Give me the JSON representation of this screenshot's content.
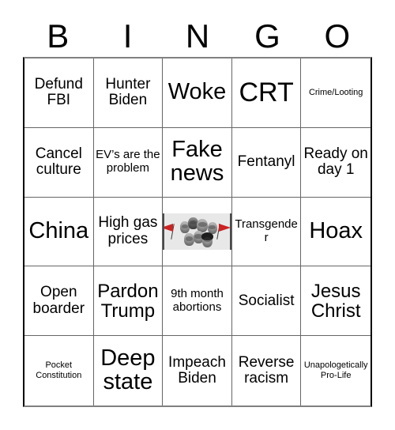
{
  "card": {
    "header_letters": [
      "B",
      "I",
      "N",
      "G",
      "O"
    ],
    "rows": [
      [
        {
          "text": "Defund FBI",
          "size": "m"
        },
        {
          "text": "Hunter Biden",
          "size": "m"
        },
        {
          "text": "Woke",
          "size": "xl"
        },
        {
          "text": "CRT",
          "size": "xxl"
        },
        {
          "text": "Crime/Looting",
          "size": "xs"
        }
      ],
      [
        {
          "text": "Cancel culture",
          "size": "m"
        },
        {
          "text": "EV’s are the problem",
          "size": "s"
        },
        {
          "text": "Fake news",
          "size": "xl"
        },
        {
          "text": "Fentanyl",
          "size": "m"
        },
        {
          "text": "Ready on day 1",
          "size": "m"
        }
      ],
      [
        {
          "text": "China",
          "size": "xl"
        },
        {
          "text": "High gas prices",
          "size": "m"
        },
        {
          "text": "",
          "size": "m",
          "image": "faces-and-red-flags-collage"
        },
        {
          "text": "Transgender",
          "size": "s"
        },
        {
          "text": "Hoax",
          "size": "xl"
        }
      ],
      [
        {
          "text": "Open boarder",
          "size": "m"
        },
        {
          "text": "Pardon Trump",
          "size": "l"
        },
        {
          "text": "9th month abortions",
          "size": "s"
        },
        {
          "text": "Socialist",
          "size": "m"
        },
        {
          "text": "Jesus Christ",
          "size": "l"
        }
      ],
      [
        {
          "text": "Pocket Constitution",
          "size": "xs"
        },
        {
          "text": "Deep state",
          "size": "xl"
        },
        {
          "text": "Impeach Biden",
          "size": "m"
        },
        {
          "text": "Reverse racism",
          "size": "m"
        },
        {
          "text": "Unapologetically Pro-Life",
          "size": "xs"
        }
      ]
    ]
  },
  "colors": {
    "background": "#ffffff",
    "text": "#000000",
    "grid_line": "#666666",
    "grid_border": "#000000",
    "collage_background": "#e8e8e8",
    "flag_red": "#cc2222"
  }
}
